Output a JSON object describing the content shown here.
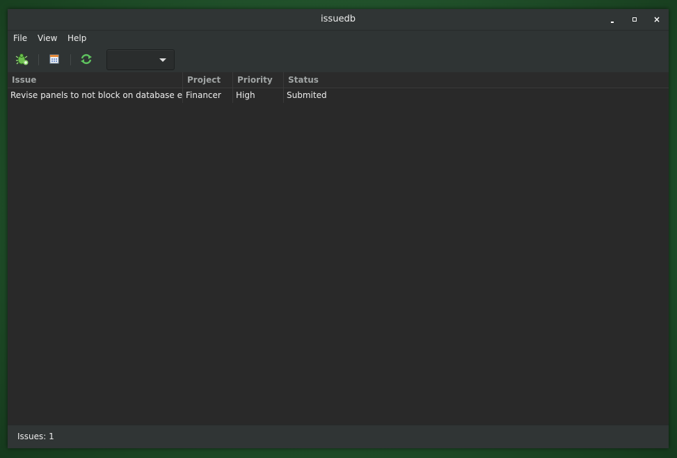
{
  "window": {
    "title": "issuedb"
  },
  "menu": {
    "items": [
      "File",
      "View",
      "Help"
    ]
  },
  "toolbar": {
    "buttons": [
      {
        "icon": "new-issue-icon"
      },
      {
        "icon": "calendar-icon"
      },
      {
        "icon": "refresh-icon"
      }
    ],
    "filter_value": ""
  },
  "table": {
    "columns": [
      "Issue",
      "Project",
      "Priority",
      "Status"
    ],
    "rows": [
      {
        "issue": "Revise panels to not block on database error",
        "project": "Financer",
        "priority": "High",
        "status": "Submited"
      }
    ]
  },
  "statusbar": {
    "text": "Issues: 1"
  },
  "colors": {
    "accent_green": "#5fc35f",
    "background": "#2b2b2b"
  }
}
